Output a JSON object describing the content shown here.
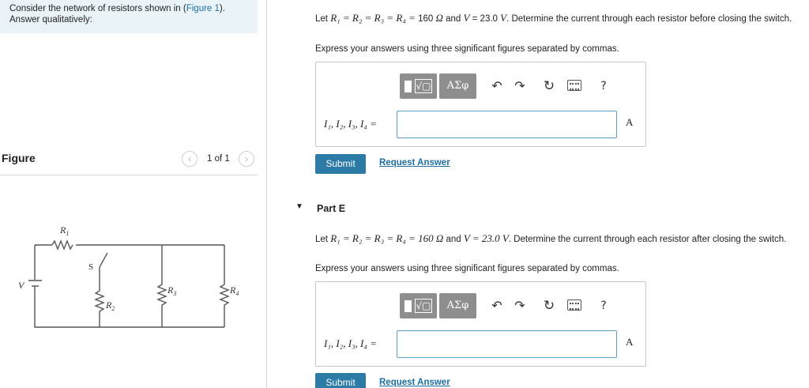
{
  "intro": {
    "text_before": "Consider the network of resistors shown in (",
    "link": "Figure 1",
    "text_after": ").",
    "line2": "Answer qualitatively:"
  },
  "figure": {
    "title": "Figure",
    "count": "1 of 1",
    "prev_icon": "‹",
    "next_icon": "›",
    "labels": {
      "r1": "R",
      "r1_sub": "1",
      "r2": "R",
      "r2_sub": "2",
      "r3": "R",
      "r3_sub": "3",
      "r4": "R",
      "r4_sub": "4",
      "switch": "S",
      "voltage": "V"
    }
  },
  "part_d": {
    "statement_lead": "Let ",
    "r_expr": "R₁ = R₂ = R₃ = R₄ = ",
    "r_value": "160",
    "ohm": "Ω",
    "and": " and ",
    "v_var": "V",
    "v_value": " = 23.0 ",
    "v_unit": "V",
    "statement_rest": ". Determine the current through each resistor before closing the switch.",
    "instruction": "Express your answers using three significant figures separated by commas.",
    "answer_label": "I₁, I₂, I₃, I₄ =",
    "answer_value": "",
    "unit": "A",
    "submit_label": "Submit",
    "request_label": "Request Answer"
  },
  "part_e": {
    "toggle_icon": "▼",
    "title": "Part E",
    "statement_lead": "Let ",
    "r_expr": "R₁ = R₂ = R₃ = R₄ = 160 Ω",
    "and": " and ",
    "v_expr": "V = 23.0 V",
    "statement_rest": ". Determine the current through each resistor after closing the switch.",
    "instruction": "Express your answers using three significant figures separated by commas.",
    "answer_label": "I₁, I₂, I₃, I₄ =",
    "answer_value": "",
    "unit": "A",
    "submit_label": "Submit",
    "request_label": "Request Answer"
  },
  "toolbar": {
    "templates_icon": "√▢",
    "symbols_label": "ΑΣφ",
    "undo_icon": "↶",
    "redo_icon": "↷",
    "reset_icon": "↻",
    "help_label": "?"
  }
}
